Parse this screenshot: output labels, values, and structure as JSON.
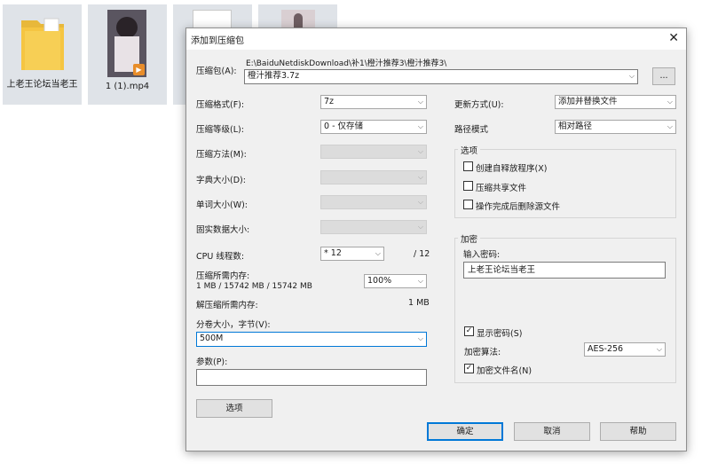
{
  "desktop": {
    "files": [
      {
        "label": "上老王论坛当老王"
      },
      {
        "label": "1 (1).mp4"
      },
      {
        "label": ""
      },
      {
        "label": ""
      }
    ]
  },
  "dialog": {
    "title": "添加到压缩包",
    "close_glyph": "✕",
    "archive_label": "压缩包(A):",
    "archive_path": "E:\\BaiduNetdiskDownload\\补1\\橙汁推荐3\\橙汁推荐3\\",
    "archive_name": "橙汁推荐3.7z",
    "browse_label": "...",
    "format": {
      "label": "压缩格式(F):",
      "value": "7z"
    },
    "level": {
      "label": "压缩等级(L):",
      "value": "0 - 仅存储"
    },
    "method": {
      "label": "压缩方法(M):",
      "value": ""
    },
    "dict_size": {
      "label": "字典大小(D):",
      "value": ""
    },
    "word_size": {
      "label": "单词大小(W):",
      "value": ""
    },
    "solid_size": {
      "label": "固实数据大小:",
      "value": ""
    },
    "cpu_threads": {
      "label": "CPU 线程数:",
      "value": "* 12",
      "max": "/ 12"
    },
    "compress_mem": {
      "label": "压缩所需内存:",
      "detail": "1 MB / 15742 MB / 15742 MB",
      "percent": "100%"
    },
    "decompress_mem": {
      "label": "解压缩所需内存:",
      "value": "1 MB"
    },
    "volume_size": {
      "label": "分卷大小，字节(V):",
      "value": "500M"
    },
    "params": {
      "label": "参数(P):",
      "value": ""
    },
    "options_button": "选项",
    "update_mode": {
      "label": "更新方式(U):",
      "value": "添加并替换文件"
    },
    "path_mode": {
      "label": "路径模式",
      "value": "相对路径"
    },
    "options_group": {
      "title": "选项",
      "items": [
        {
          "label": "创建自释放程序(X)",
          "checked": false
        },
        {
          "label": "压缩共享文件",
          "checked": false
        },
        {
          "label": "操作完成后删除源文件",
          "checked": false
        }
      ]
    },
    "encryption": {
      "title": "加密",
      "password_label": "输入密码:",
      "password_value": "上老王论坛当老王",
      "show_password": {
        "label": "显示密码(S)",
        "checked": true
      },
      "method_label": "加密算法:",
      "method_value": "AES-256",
      "encrypt_names": {
        "label": "加密文件名(N)",
        "checked": true
      }
    },
    "ok_button": "确定",
    "cancel_button": "取消",
    "help_button": "帮助"
  },
  "colors": {
    "accent": "#0078d7",
    "dialog_bg": "#f0f0f0",
    "folder": "#f5c542"
  }
}
